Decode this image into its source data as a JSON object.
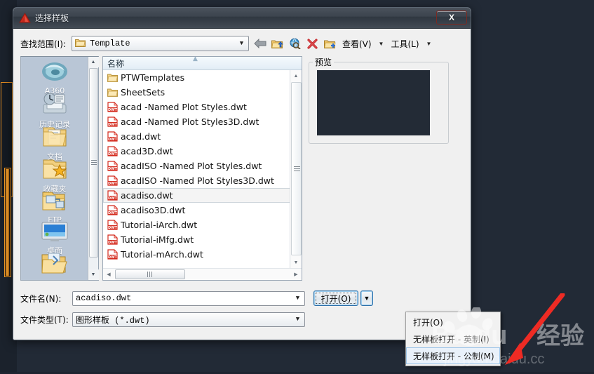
{
  "window": {
    "title": "选择样板",
    "app_icon": "autocad-red-triangle-icon",
    "close_label": "X"
  },
  "lookin": {
    "label": "查找范围(I):",
    "value": "Template",
    "icon": "folder-icon",
    "dropdown_arrow": "▼"
  },
  "toolbar": {
    "buttons": [
      {
        "name": "back-button",
        "icon": "back-arrow-icon",
        "label": ""
      },
      {
        "name": "up-one-level-button",
        "icon": "folder-up-icon",
        "label": ""
      },
      {
        "name": "search-web-button",
        "icon": "search-web-icon",
        "label": ""
      },
      {
        "name": "delete-button",
        "icon": "delete-x-icon",
        "label": ""
      },
      {
        "name": "new-folder-button",
        "icon": "folder-new-icon",
        "label": ""
      }
    ],
    "view_menu": "查看(V)",
    "tools_menu": "工具(L)",
    "menu_arrow": "▼"
  },
  "places": [
    {
      "label": "A360",
      "icon": "a360-cloud-icon"
    },
    {
      "label": "历史记录",
      "icon": "history-icon"
    },
    {
      "label": "文档",
      "icon": "documents-folder-icon"
    },
    {
      "label": "收藏夹",
      "icon": "favorites-star-folder-icon"
    },
    {
      "label": "FTP",
      "icon": "ftp-folder-icon"
    },
    {
      "label": "桌面",
      "icon": "desktop-monitor-icon"
    },
    {
      "label": "",
      "icon": "open-folder-icon"
    }
  ],
  "filelist": {
    "column_header": "名称",
    "sort_indicator": "▲",
    "items": [
      {
        "name": "PTWTemplates",
        "type": "folder",
        "selected": false
      },
      {
        "name": "SheetSets",
        "type": "folder",
        "selected": false
      },
      {
        "name": "acad -Named Plot Styles.dwt",
        "type": "dwt",
        "selected": false
      },
      {
        "name": "acad -Named Plot Styles3D.dwt",
        "type": "dwt",
        "selected": false
      },
      {
        "name": "acad.dwt",
        "type": "dwt",
        "selected": false
      },
      {
        "name": "acad3D.dwt",
        "type": "dwt",
        "selected": false
      },
      {
        "name": "acadISO -Named Plot Styles.dwt",
        "type": "dwt",
        "selected": false
      },
      {
        "name": "acadISO -Named Plot Styles3D.dwt",
        "type": "dwt",
        "selected": false
      },
      {
        "name": "acadiso.dwt",
        "type": "dwt",
        "selected": true
      },
      {
        "name": "acadiso3D.dwt",
        "type": "dwt",
        "selected": false
      },
      {
        "name": "Tutorial-iArch.dwt",
        "type": "dwt",
        "selected": false
      },
      {
        "name": "Tutorial-iMfg.dwt",
        "type": "dwt",
        "selected": false
      },
      {
        "name": "Tutorial-mArch.dwt",
        "type": "dwt",
        "selected": false
      }
    ],
    "scroll_up_arrow": "▲",
    "scroll_down_arrow": "▼",
    "scroll_left_arrow": "◀",
    "scroll_right_arrow": "▶"
  },
  "preview": {
    "legend": "预览",
    "canvas_color": "#232b36"
  },
  "filename": {
    "label": "文件名(N):",
    "value": "acadiso.dwt",
    "arrow": "▼"
  },
  "filetype": {
    "label": "文件类型(T):",
    "value": "图形样板 (*.dwt)",
    "arrow": "▼"
  },
  "open_button": {
    "label": "打开(O)",
    "split_arrow": "▼"
  },
  "open_menu": {
    "items": [
      {
        "label": "打开(O)",
        "highlighted": false
      },
      {
        "label": "无样板打开 - 英制(I)",
        "highlighted": false
      },
      {
        "label": "无样板打开 - 公制(M)",
        "highlighted": true
      }
    ]
  },
  "watermark": {
    "text": "Baidu",
    "suffix": "经验",
    "url": "jingyan.baidu.com"
  },
  "annotation": {
    "arrow_color": "#ee2b24",
    "points_to": "无样板打开 - 公制(M)"
  },
  "colors": {
    "accent": "#2d6fa8",
    "dwt_icon": "#d42b1e",
    "places_bg": "#b9c6d6",
    "title_bg": "#3c444e"
  }
}
